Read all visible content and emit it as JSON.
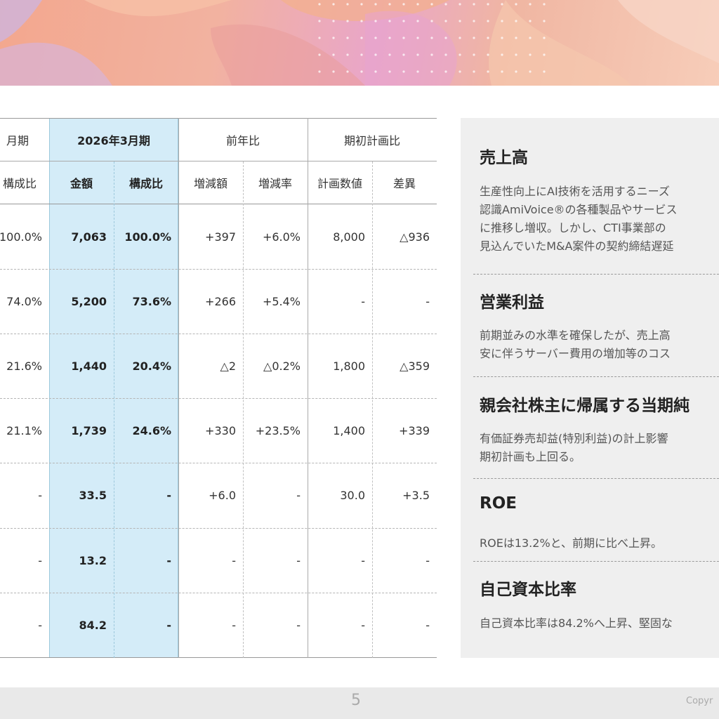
{
  "table": {
    "headers": {
      "prev_period": "月期",
      "current_period": "2026年3月期",
      "yoy": "前年比",
      "plan": "期初計画比"
    },
    "subheaders": [
      "構成比",
      "金額",
      "構成比",
      "増減額",
      "増減率",
      "計画数値",
      "差異"
    ],
    "rows": [
      [
        "100.0%",
        "7,063",
        "100.0%",
        "+397",
        "+6.0%",
        "8,000",
        "△936"
      ],
      [
        "74.0%",
        "5,200",
        "73.6%",
        "+266",
        "+5.4%",
        "-",
        "-"
      ],
      [
        "21.6%",
        "1,440",
        "20.4%",
        "△2",
        "△0.2%",
        "1,800",
        "△359"
      ],
      [
        "21.1%",
        "1,739",
        "24.6%",
        "+330",
        "+23.5%",
        "1,400",
        "+339"
      ],
      [
        "-",
        "33.5",
        "-",
        "+6.0",
        "-",
        "30.0",
        "+3.5"
      ],
      [
        "-",
        "13.2",
        "-",
        "-",
        "-",
        "-",
        "-"
      ],
      [
        "-",
        "84.2",
        "-",
        "-",
        "-",
        "-",
        "-"
      ]
    ]
  },
  "commentary": [
    {
      "title": "売上高",
      "lines": [
        "生産性向上にAI技術を活用するニーズ",
        "認識AmiVoice®の各種製品やサービス",
        "に推移し増収。しかし、CTI事業部の",
        "見込んでいたM&A案件の契約締結遅延"
      ]
    },
    {
      "title": "営業利益",
      "lines": [
        "前期並みの水準を確保したが、売上高",
        "安に伴うサーバー費用の増加等のコス"
      ]
    },
    {
      "title": "親会社株主に帰属する当期純",
      "lines": [
        "有価証券売却益(特別利益)の計上影響",
        "期初計画も上回る。"
      ]
    },
    {
      "title": "ROE",
      "lines": [
        "ROEは13.2%と、前期に比べ上昇。"
      ]
    },
    {
      "title": "自己資本比率",
      "lines": [
        "自己資本比率は84.2%へ上昇、堅固な"
      ]
    }
  ],
  "footer": {
    "page_number": "5",
    "copyright": "Copyr"
  }
}
